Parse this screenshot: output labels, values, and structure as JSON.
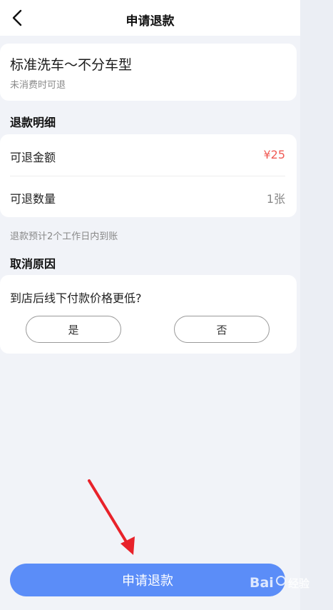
{
  "header": {
    "title": "申请退款"
  },
  "product": {
    "name": "标准洗车～不分车型",
    "subtitle": "未消费时可退"
  },
  "refund_detail": {
    "section_title": "退款明细",
    "rows": [
      {
        "label": "可退金额",
        "value": "¥25",
        "value_color": "#f05b55"
      },
      {
        "label": "可退数量",
        "value": "1张",
        "value_color": "#888888"
      }
    ],
    "note": "退款预计2个工作日内到账"
  },
  "cancel_reason": {
    "section_title": "取消原因",
    "question": "到店后线下付款价格更低?",
    "options": [
      "是",
      "否"
    ]
  },
  "footer": {
    "submit_label": "申请退款"
  },
  "watermark": {
    "text": "Bai 经验"
  },
  "colors": {
    "accent": "#5b8df8",
    "price": "#f05b55",
    "annotation_arrow": "#e8222a"
  }
}
